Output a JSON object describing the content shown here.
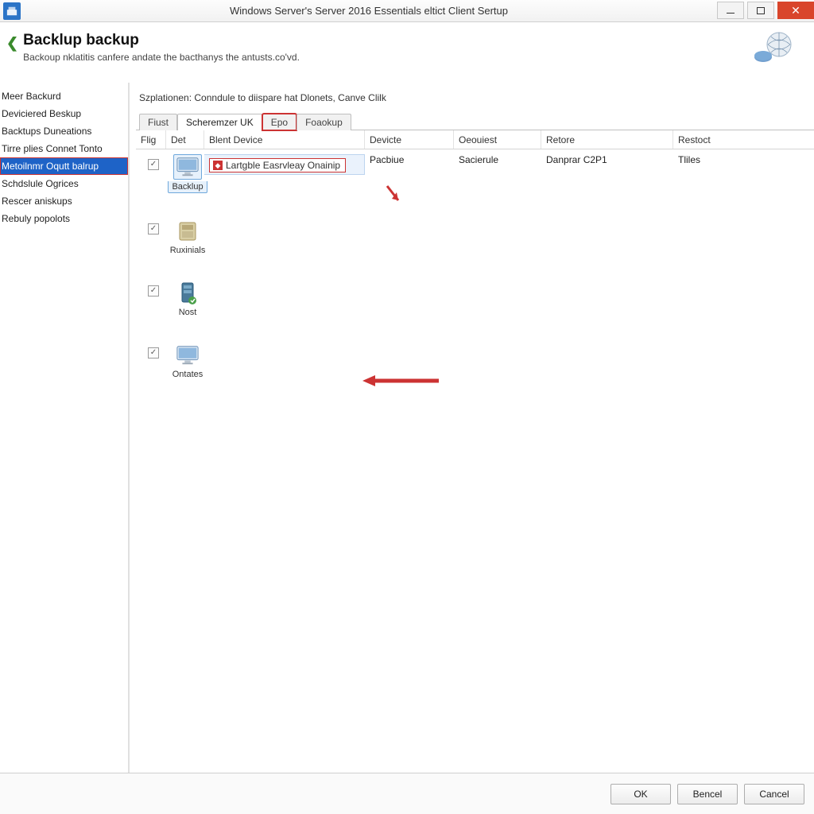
{
  "window": {
    "title": "Windows Server's Server 2016 Essentials eltict Client Sertup"
  },
  "header": {
    "title": "Backlup backup",
    "subtitle": "Backoup nklatitis canfere andate the bacthanys the antusts.co'vd."
  },
  "sidebar": {
    "items": [
      {
        "label": "Meer Backurd"
      },
      {
        "label": "Deviciered Beskup"
      },
      {
        "label": "Backtups Duneations"
      },
      {
        "label": "Tirre plies Connet Tonto"
      },
      {
        "label": "Metoilnmr Oqutt balrup",
        "selected": true
      },
      {
        "label": "Schdslule Ogrices"
      },
      {
        "label": "Rescer aniskups"
      },
      {
        "label": "Rebuly popolots"
      }
    ]
  },
  "content": {
    "explain": "Szplationen: Conndule to diispare hat Dlonets, Canve Clilk",
    "tabs": [
      {
        "label": "Fiust"
      },
      {
        "label": "Scheremzer UK",
        "active": true
      },
      {
        "label": "Epo",
        "marked": true
      },
      {
        "label": "Foaokup"
      }
    ],
    "columns": {
      "flag": "Flig",
      "det": "Det",
      "device": "Blent Device",
      "dev2": "Devicte",
      "request": "Oeouiest",
      "retore": "Retore",
      "restoct": "Restoct"
    },
    "rows": [
      {
        "checked": true,
        "icon": "monitor",
        "icon_label": "Backlup",
        "selected": true,
        "name_tag": "Lartgble Easrvleay Onainip",
        "dev2": "Pacbiue",
        "request": "Sacierule",
        "retore": "Danprar C2P1",
        "restoct": "Tliles"
      },
      {
        "checked": true,
        "icon": "drive",
        "icon_label": "Ruxinials"
      },
      {
        "checked": true,
        "icon": "server",
        "icon_label": "Nost"
      },
      {
        "checked": true,
        "icon": "monitor",
        "icon_label": "Ontates",
        "arrow": true
      }
    ]
  },
  "footer": {
    "ok": "OK",
    "bencel": "Bencel",
    "cancel": "Cancel"
  }
}
